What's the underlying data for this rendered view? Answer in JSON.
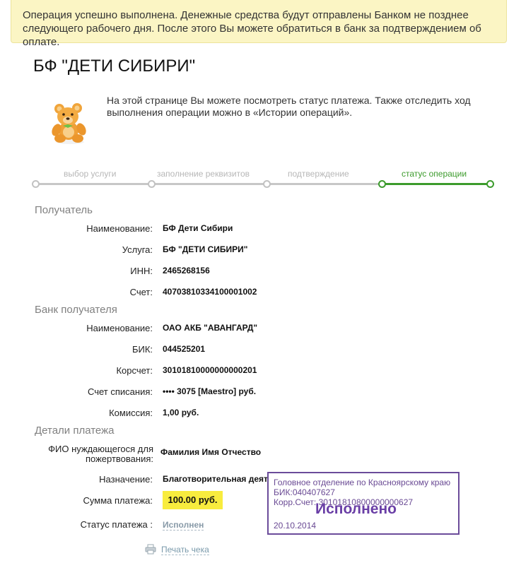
{
  "notice": {
    "line1": "Операция успешно выполнена. Денежные средства будут отправлены Банком не позднее",
    "line2": "следующего рабочего дня. После этого Вы можете обратиться в банк за подтверждением об оплате."
  },
  "title": "БФ \"ДЕТИ СИБИРИ\"",
  "intro": {
    "line1": "На этой странице Вы можете посмотреть статус платежа. Также отследить ход",
    "line2": "выполнения операции можно в «Истории операций»."
  },
  "steps": [
    {
      "label": "выбор услуги",
      "active": false
    },
    {
      "label": "заполнение реквизитов",
      "active": false
    },
    {
      "label": "подтверждение",
      "active": false
    },
    {
      "label": "статус операции",
      "active": true
    }
  ],
  "recipient": {
    "heading": "Получатель",
    "name_label": "Наименование:",
    "name_value": "БФ Дети Сибири",
    "service_label": "Услуга:",
    "service_value": "БФ \"ДЕТИ СИБИРИ\"",
    "inn_label": "ИНН:",
    "inn_value": "2465268156",
    "account_label": "Счет:",
    "account_value": "40703810334100001002"
  },
  "bank": {
    "heading": "Банк получателя",
    "name_label": "Наименование:",
    "name_value": "ОАО АКБ \"АВАНГАРД\"",
    "bik_label": "БИК:",
    "bik_value": "044525201",
    "corr_label": "Корсчет:",
    "corr_value": "30101810000000000201",
    "debit_label": "Счет списания:",
    "debit_value": "•••• 3075  [Maestro]  руб.",
    "fee_label": "Комиссия:",
    "fee_value": "1,00 руб."
  },
  "details": {
    "heading": "Детали платежа",
    "fio_label_line1": "ФИО нуждающегося для",
    "fio_label_line2": "пожертвования:",
    "fio_value": "Фамилия Имя Отчество",
    "purpose_label": "Назначение:",
    "purpose_value": "Благотворительная деятельность",
    "amount_label": "Сумма платежа:",
    "amount_value": "100.00 руб.",
    "status_label": "Статус платежа :",
    "status_value": "Исполнен"
  },
  "print_label": "Печать чека",
  "stamp": {
    "line1": "Головное отделение по Красноярскому краю",
    "line2": "БИК:040407627",
    "line3": "Корр.Счет: 30101810800000000627",
    "status": "Исполнено",
    "date": "20.10.2014"
  },
  "colors": {
    "notice_bg": "#fbf5c4",
    "accent_green": "#3c9b2c",
    "amount_highlight": "#f8ec3e",
    "stamp_purple": "#6b4c9a"
  }
}
